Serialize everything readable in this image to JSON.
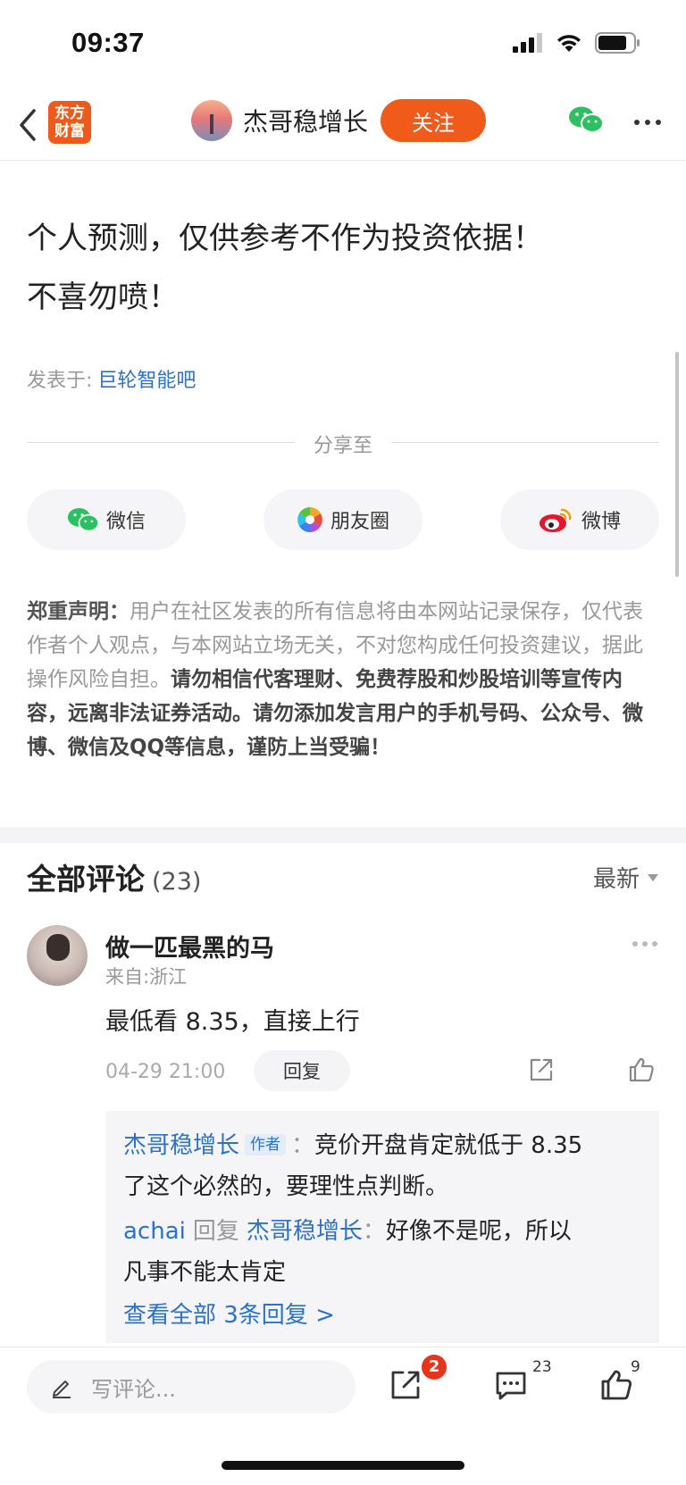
{
  "status_bar": {
    "time": "09:37"
  },
  "nav": {
    "logo_line1": "东方",
    "logo_line2": "财富",
    "author": "杰哥稳增长",
    "follow_label": "关注"
  },
  "post": {
    "line1": "个人预测，仅供参考不作为投资依据！",
    "line2": "不喜勿喷！",
    "posted_in_label": "发表于:",
    "posted_in_forum": "巨轮智能吧"
  },
  "share": {
    "title": "分享至",
    "items": [
      {
        "label": "微信",
        "icon": "wechat-icon"
      },
      {
        "label": "朋友圈",
        "icon": "moments-icon"
      },
      {
        "label": "微博",
        "icon": "weibo-icon"
      }
    ]
  },
  "disclaimer": {
    "heading": "郑重声明：",
    "normal": "用户在社区发表的所有信息将由本网站记录保存，仅代表作者个人观点，与本网站立场无关，不对您构成任何投资建议，据此操作风险自担。",
    "bold": "请勿相信代客理财、免费荐股和炒股培训等宣传内容，远离非法证券活动。请勿添加发言用户的手机号码、公众号、微博、微信及QQ等信息，谨防上当受骗！"
  },
  "comments": {
    "title": "全部评论",
    "count": "(23)",
    "sort_label": "最新",
    "items": [
      {
        "name": "做一匹最黑的马",
        "from": "来自:浙江",
        "body": "最低看 8.35，直接上行",
        "time": "04-29 21:00",
        "reply_label": "回复",
        "replies": [
          {
            "user": "杰哥稳增长",
            "tag": "作者",
            "sep": "：",
            "text_a": "竞价开盘肯定就低于 8.35",
            "text_b": "了这个必然的，要理性点判断。"
          },
          {
            "user": "achai",
            "mid": "回复",
            "target": "杰哥稳增长",
            "sep": "：",
            "text_a": "好像不是呢，所以",
            "text_b": "凡事不能太肯定"
          }
        ],
        "view_all": "查看全部 3条回复 >"
      }
    ]
  },
  "bottom_bar": {
    "input_placeholder": "写评论...",
    "share_badge": "2",
    "comment_count": "23",
    "like_count": "9"
  }
}
